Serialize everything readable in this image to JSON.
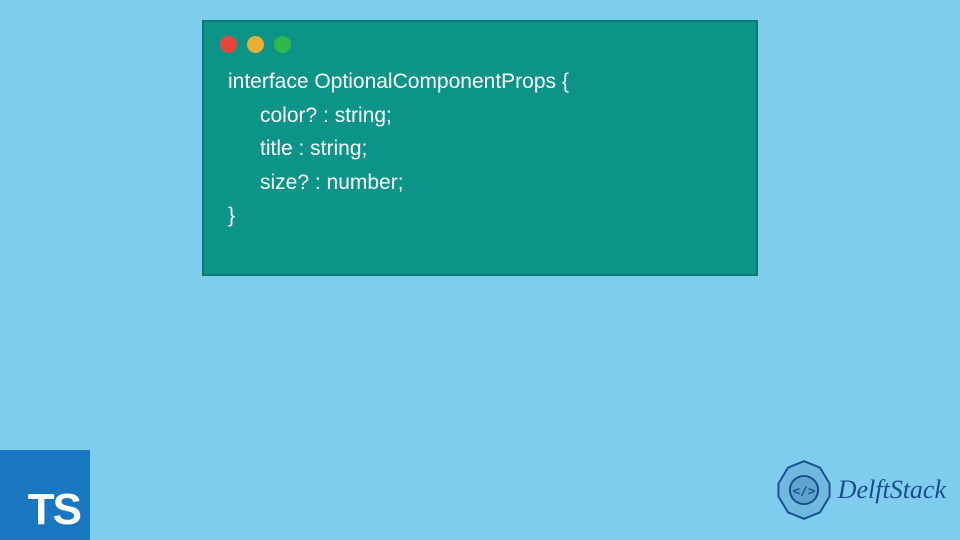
{
  "code": {
    "line1": "interface OptionalComponentProps {",
    "line2": "color? : string;",
    "line3": "title : string;",
    "line4": "size? : number;",
    "line5": "}"
  },
  "ts_badge": "TS",
  "brand": "DelftStack"
}
